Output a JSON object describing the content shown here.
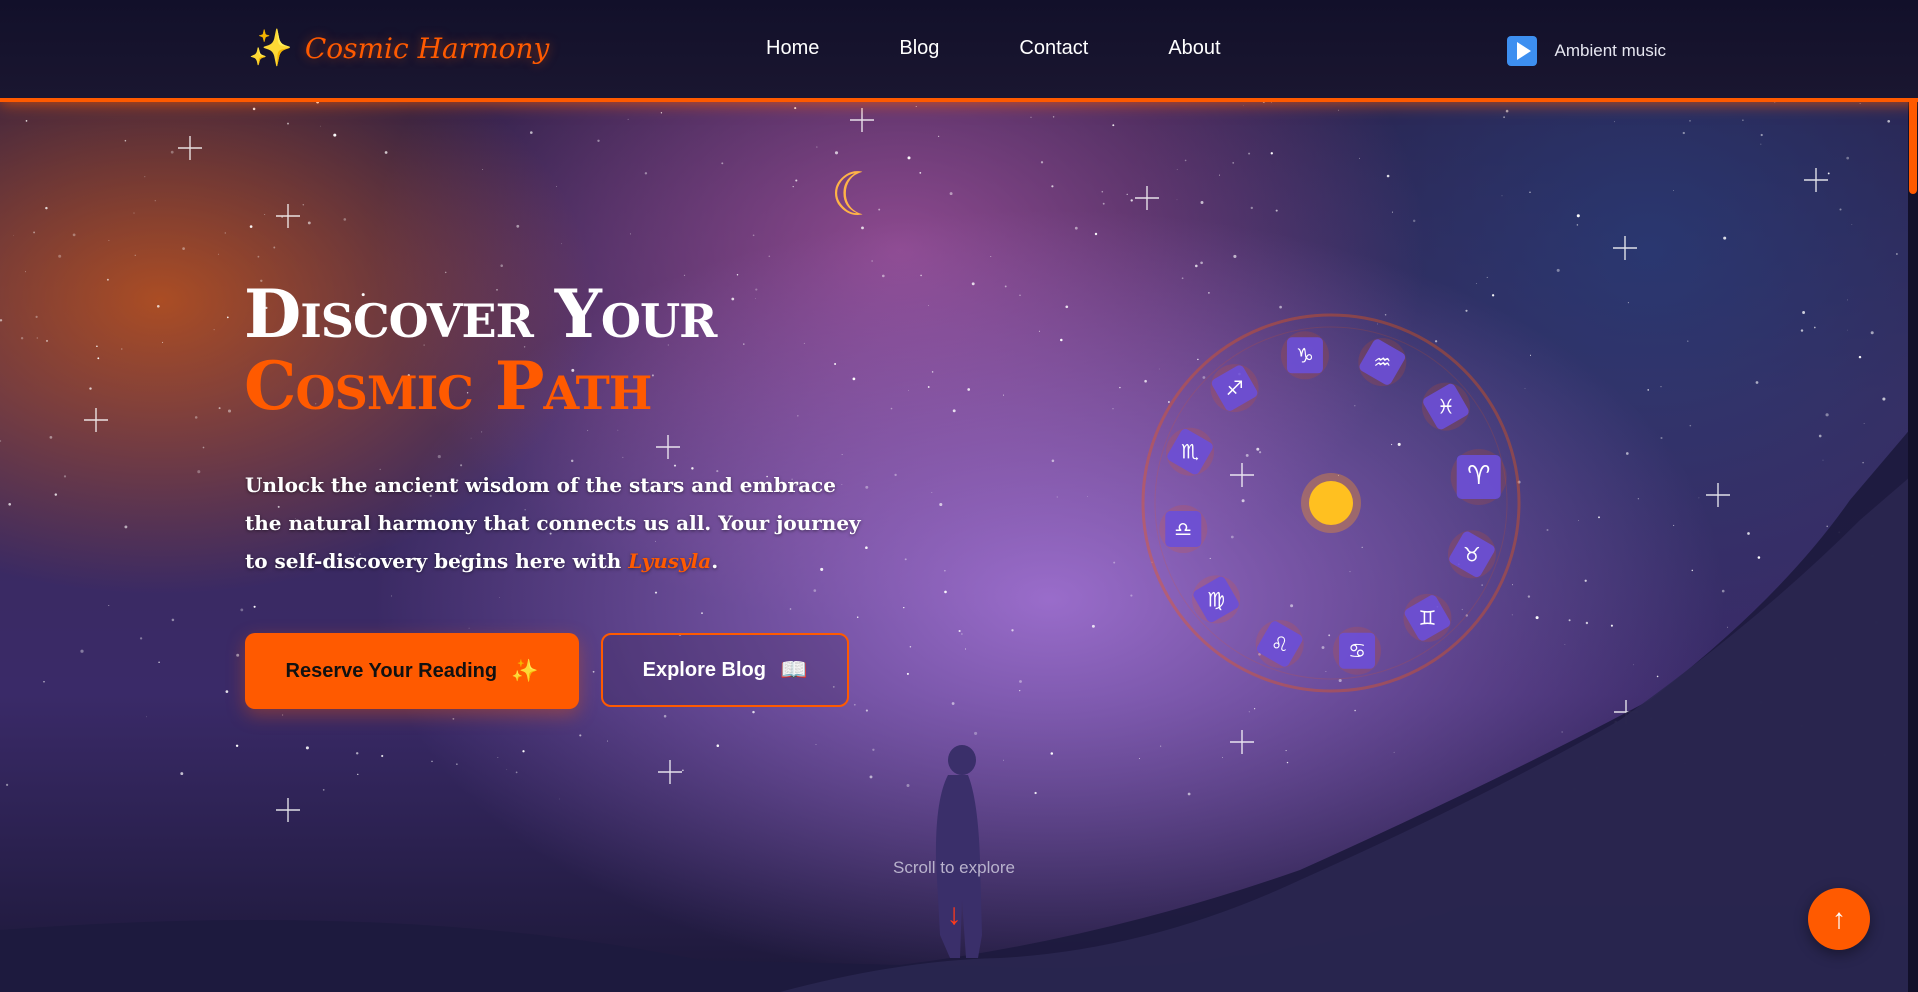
{
  "header": {
    "logo_icon": "✨",
    "logo_text": "Cosmic Harmony",
    "nav": [
      {
        "label": "Home"
      },
      {
        "label": "Blog"
      },
      {
        "label": "Contact"
      },
      {
        "label": "About"
      }
    ],
    "music_label": "Ambient music",
    "music_icon": "play-icon"
  },
  "hero": {
    "title_plain": "Discover Your ",
    "title_accent": "Cosmic Path",
    "description_main": "Unlock the ancient wisdom of the stars and embrace the natural harmony that connects us all. Your journey to self-discovery begins here with ",
    "description_brand": "Lyusyla",
    "description_end": ".",
    "primary_button": "Reserve Your Reading",
    "primary_button_icon": "✨",
    "secondary_button": "Explore Blog",
    "secondary_button_icon": "📖"
  },
  "zodiac": {
    "signs": [
      "♈",
      "♉",
      "♊",
      "♋",
      "♌",
      "♍",
      "♎",
      "♏",
      "♐",
      "♑",
      "♒",
      "♓"
    ],
    "center_icon": "sun-icon"
  },
  "decor": {
    "moon_icon": "crescent-moon-icon"
  },
  "footer_hint": {
    "scroll_text": "Scroll to explore",
    "scroll_arrow": "↓",
    "to_top": "↑"
  },
  "colors": {
    "accent": "#ff5a00",
    "zodiac_tile": "#6a4fd8",
    "sun": "#ffc020"
  }
}
